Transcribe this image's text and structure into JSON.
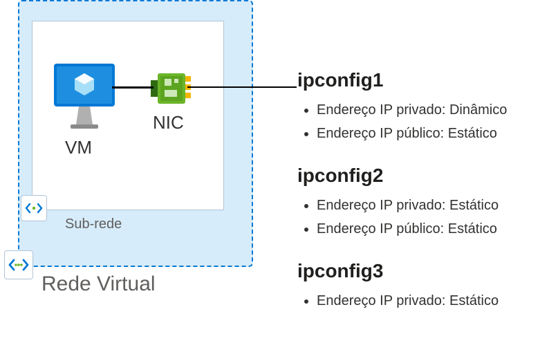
{
  "diagram": {
    "vnet_label": "Rede Virtual",
    "subnet_label": "Sub-rede",
    "vm_label": "VM",
    "nic_label": "NIC"
  },
  "configs": [
    {
      "name": "ipconfig1",
      "items": [
        "Endereço IP privado: Dinâmico",
        "Endereço IP público: Estático"
      ]
    },
    {
      "name": "ipconfig2",
      "items": [
        "Endereço IP privado: Estático",
        "Endereço IP público: Estático"
      ]
    },
    {
      "name": "ipconfig3",
      "items": [
        "Endereço IP privado: Estático"
      ]
    }
  ],
  "colors": {
    "azure_blue": "#0078d4",
    "bg_blue": "#d6ecfb",
    "nic_green": "#6bb52a"
  }
}
